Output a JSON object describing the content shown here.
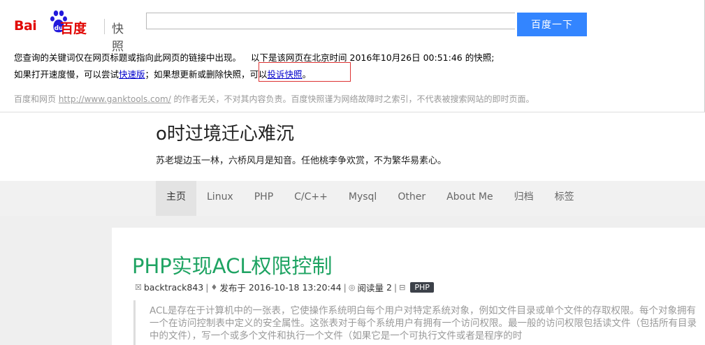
{
  "baidu": {
    "logo_bai": "Bai",
    "logo_du": "du",
    "logo_baidu_hz": "百度",
    "logo_kuaizhao": "快照",
    "search_value": "",
    "search_button": "百度一下",
    "line1_a": "您查询的关键词仅在网页标题或指向此网页的链接中出现。",
    "line1_b": "以下是该网页在北京时间 2016年10月26日 00:51:46 的快照;",
    "line2_a": "如果打开速度慢，可以尝试",
    "line2_link1": "快速版",
    "line2_b": "；如果想更新或删除快照，可以",
    "line2_link2": "投诉快照",
    "line2_c": "。",
    "disc_a": "百度和网页 ",
    "disc_link": "http://www.ganktools.com/",
    "disc_b": " 的作者无关，不对其内容负责。百度快照谨为网络故障时之索引，不代表被搜索网站的即时页面。"
  },
  "blog": {
    "title": "o时过境迁心难沉",
    "description": "苏老堤边玉一林，六桥风月是知音。任他桃李争欢赏，不为繁华易素心。",
    "nav": [
      "主页",
      "Linux",
      "PHP",
      "C/C++",
      "Mysql",
      "Other",
      "About Me",
      "归档",
      "标签"
    ],
    "nav_active": "主页"
  },
  "post": {
    "title": "PHP实现ACL权限控制",
    "author": "backtrack843",
    "published_label": "发布于",
    "published": "2016-10-18 13:20:44",
    "reads_label": "阅读量",
    "reads": "2",
    "tag": "PHP",
    "excerpt_1": "ACL是存在于计算机中的一张表，它使操作系统明白每个用户对特定系统对象，例如文件目录或单个文件的存取权限。每个对象拥有一个在访问控制表中定义的安全属性。这张表对于每个系统用户有拥有一个访问权限。最一般的访问权限包括读文件（包括所有目录中的文件），写一个或多个文件和执行一个文件（如果它是一个可执行文件或者是程序的时"
  },
  "colors": {
    "baidu_red": "#e10602",
    "baidu_blue": "#2319dc",
    "search_button": "#3385ff",
    "post_title": "#1ea362",
    "tag_bg": "#3c4149"
  }
}
